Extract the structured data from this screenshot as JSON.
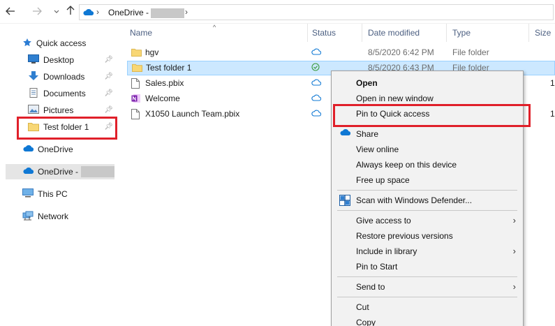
{
  "address": {
    "location": "OneDrive -",
    "back_icon": "back-arrow-icon",
    "forward_icon": "forward-arrow-icon",
    "history_icon": "chevron-down-icon",
    "up_icon": "up-arrow-icon"
  },
  "nav": {
    "quick_access": "Quick access",
    "desktop": "Desktop",
    "downloads": "Downloads",
    "documents": "Documents",
    "pictures": "Pictures",
    "test_folder": "Test folder 1",
    "onedrive": "OneDrive",
    "onedrive_business": "OneDrive -",
    "this_pc": "This PC",
    "network": "Network"
  },
  "columns": {
    "name": "Name",
    "status": "Status",
    "date_modified": "Date modified",
    "type": "Type",
    "size": "Size"
  },
  "files": [
    {
      "name": "hgv",
      "date": "8/5/2020 6:42 PM",
      "type": "File folder",
      "size": "",
      "status": "cloud",
      "icon": "folder-icon"
    },
    {
      "name": "Test folder 1",
      "date": "8/5/2020 6:43 PM",
      "type": "File folder",
      "size": "",
      "status": "synced",
      "icon": "folder-icon"
    },
    {
      "name": "Sales.pbix",
      "date": "",
      "type": "",
      "size": "1",
      "status": "cloud",
      "icon": "file-icon"
    },
    {
      "name": "Welcome",
      "date": "",
      "type": "",
      "size": "",
      "status": "cloud",
      "icon": "onenote-icon"
    },
    {
      "name": "X1050 Launch Team.pbix",
      "date": "",
      "type": "",
      "size": "1",
      "status": "cloud",
      "icon": "file-icon"
    }
  ],
  "context_menu": {
    "open": "Open",
    "open_new_window": "Open in new window",
    "pin_quick_access": "Pin to Quick access",
    "share": "Share",
    "view_online": "View online",
    "always_keep": "Always keep on this device",
    "free_up_space": "Free up space",
    "scan_defender": "Scan with Windows Defender...",
    "give_access": "Give access to",
    "restore_versions": "Restore previous versions",
    "include_library": "Include in library",
    "pin_start": "Pin to Start",
    "send_to": "Send to",
    "cut": "Cut",
    "copy": "Copy"
  },
  "colors": {
    "highlight_red": "#e0202a",
    "selection_blue": "#cce8ff",
    "onedrive_blue": "#0f78d4",
    "folder_yellow": "#f8d775",
    "synced_green": "#3a9a3a"
  }
}
